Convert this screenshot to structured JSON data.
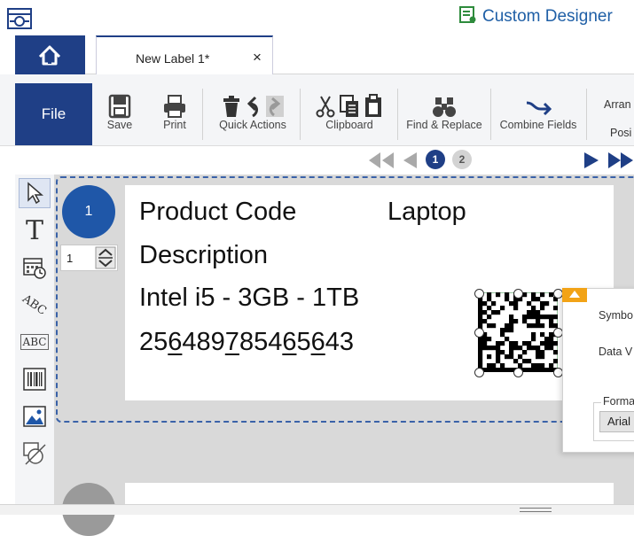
{
  "app": {
    "title": "Custom Designer"
  },
  "tabs": [
    {
      "label": "New Label 1*",
      "close": "×"
    }
  ],
  "ribbon": {
    "file_label": "File",
    "groups": [
      {
        "label": "Save"
      },
      {
        "label": "Print"
      },
      {
        "label": "Quick Actions"
      },
      {
        "label": "Clipboard"
      },
      {
        "label": "Find & Replace"
      },
      {
        "label": "Combine Fields"
      },
      {
        "label": "Arran"
      },
      {
        "label": "Posi"
      }
    ]
  },
  "page_nav": {
    "pages": [
      "1",
      "2"
    ],
    "current": "1"
  },
  "toolbox": {
    "tools": [
      {
        "name": "select-tool",
        "icon": "cursor-icon"
      },
      {
        "name": "text-tool",
        "glyph": "T"
      },
      {
        "name": "date-time-tool",
        "icon": "calendar-clock-icon"
      },
      {
        "name": "curved-text-tool",
        "glyph": "ABC"
      },
      {
        "name": "rich-text-tool",
        "glyph": "ABC"
      },
      {
        "name": "barcode-tool",
        "icon": "barcode-icon"
      },
      {
        "name": "image-tool",
        "icon": "image-icon"
      },
      {
        "name": "shape-tool",
        "icon": "shape-icon"
      }
    ]
  },
  "canvas": {
    "label_number": "1",
    "copies_value": "1",
    "fields": {
      "product_code_label": "Product Code",
      "product_code_value": "Laptop",
      "description_label": "Description",
      "description_value": "Intel i5 - 3GB - 1TB",
      "barcode_data_parts": [
        "25",
        "6",
        "489",
        "7",
        "854",
        "6",
        "5",
        "6",
        "43"
      ]
    }
  },
  "properties_popup": {
    "symbology_label": "Symbo",
    "data_value_label": "Data V",
    "format_label": "Forma",
    "font_value": "Arial"
  },
  "colors": {
    "brand": "#1f3f86",
    "accent": "#1f57a8",
    "popup_tab": "#f2a317",
    "dashed_frame": "#3a62a8"
  }
}
